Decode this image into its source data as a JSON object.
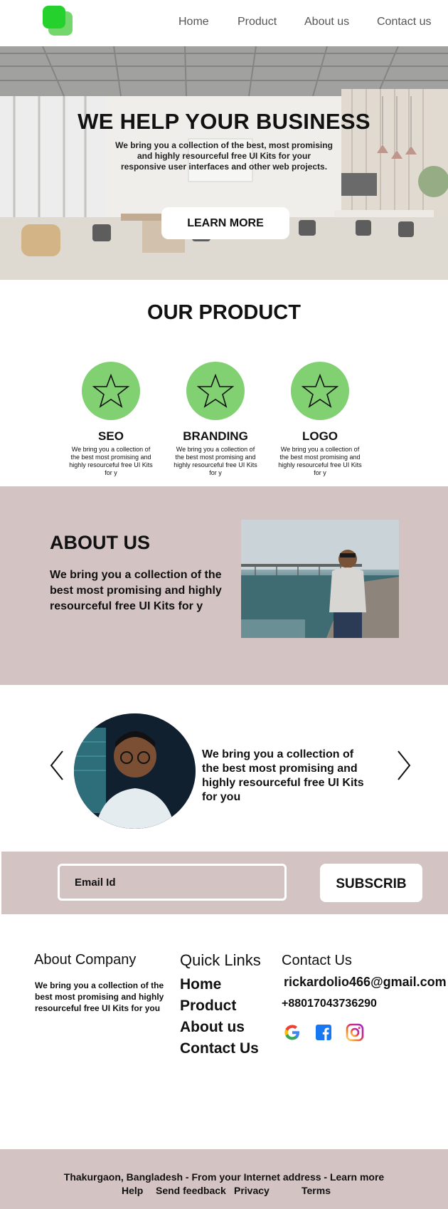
{
  "nav": {
    "links": [
      "Home",
      "Product",
      "About us",
      "Contact us"
    ],
    "logo_color": "#25d12c"
  },
  "hero": {
    "title": "WE HELP YOUR BUSINESS",
    "text": "We bring you a collection of the best, most promising and highly resourceful free UI Kits for your responsive user interfaces and other web projects.",
    "button": "LEARN MORE"
  },
  "products": {
    "title": "OUR PRODUCT",
    "icon": "star-icon",
    "accent": "#81d173",
    "items": [
      {
        "name": "SEO",
        "desc": "We bring you a collection of the best most promising and highly resourceful free UI Kits for y"
      },
      {
        "name": "BRANDING",
        "desc": "We bring you a collection of the best most promising and highly resourceful free UI Kits for y"
      },
      {
        "name": "LOGO",
        "desc": "We bring you a collection of the best most promising and highly resourceful free UI Kits for y"
      }
    ]
  },
  "about": {
    "title": "ABOUT US",
    "text": "We bring you a collection of the best most promising and highly resourceful free UI Kits for y",
    "background": "#d3c3c2"
  },
  "testimonial": {
    "text": "We bring you a collection of the best most promising and highly resourceful free UI Kits for you"
  },
  "subscribe": {
    "placeholder": "Email Id",
    "button": "SUBSCRIB"
  },
  "footer": {
    "about_title": "About  Company",
    "about_text": "We bring you a collection of the best most promising and highly resourceful free UI Kits for you",
    "links_title": "Quick Links",
    "links": [
      "Home",
      "Product",
      "About us",
      "Contact Us"
    ],
    "contact_title": "Contact Us",
    "email": "rickardolio466@gmail.com",
    "phone": "+88017043736290",
    "social_icons": [
      "google-icon",
      "facebook-icon",
      "instagram-icon"
    ]
  },
  "bottom": {
    "line": "Thakurgaon, Bangladesh - From your Internet address - Learn more",
    "links": [
      "Help",
      "Send feedback",
      "Privacy",
      "Terms"
    ]
  }
}
